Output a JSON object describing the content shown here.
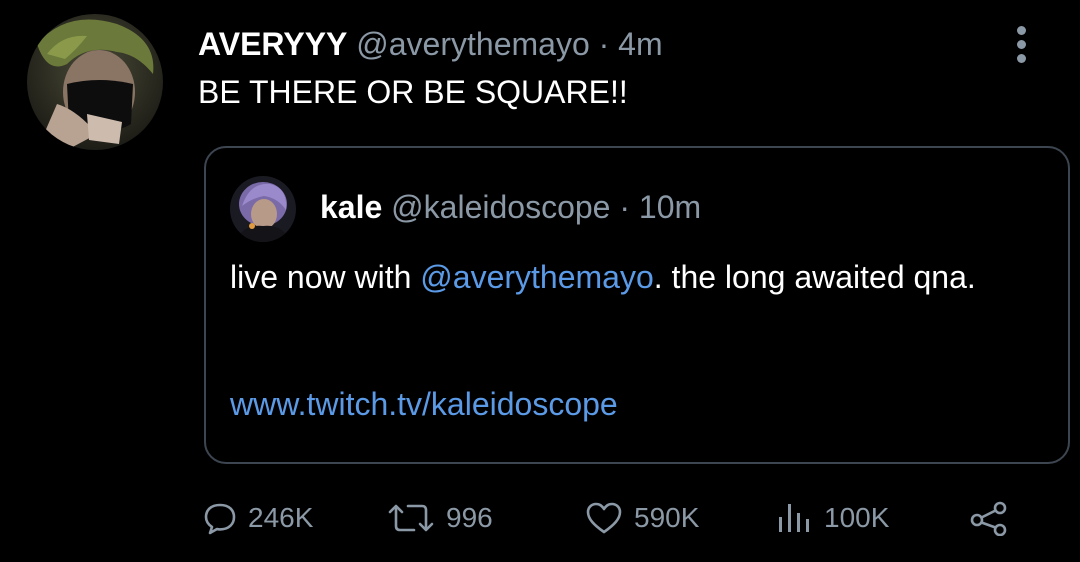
{
  "tweet": {
    "display_name": "AVERYYY",
    "handle": "@averythemayo",
    "separator": "·",
    "time": "4m",
    "text": "BE THERE OR BE SQUARE!!"
  },
  "quote": {
    "display_name": "kale",
    "handle": "@kaleidoscope",
    "separator": "·",
    "time": "10m",
    "text_before": "live now with ",
    "mention": "@averythemayo",
    "text_after": ". the long awaited qna.",
    "link": "www.twitch.tv/kaleidoscope"
  },
  "actions": {
    "replies": "246K",
    "retweets": "996",
    "likes": "590K",
    "views": "100K"
  },
  "icons": {
    "more": "more-vertical-icon",
    "reply": "reply-icon",
    "retweet": "retweet-icon",
    "like": "heart-icon",
    "views": "analytics-icon",
    "share": "share-icon"
  },
  "colors": {
    "background": "#000000",
    "text": "#ffffff",
    "secondary": "#8b98a5",
    "link": "#5b9ae6",
    "border": "#3d4650"
  }
}
